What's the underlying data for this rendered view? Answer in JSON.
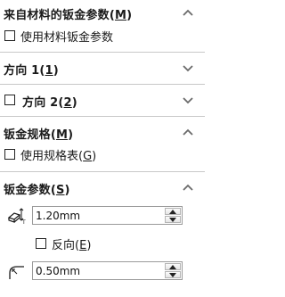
{
  "sections": {
    "custom_sheet_metal": {
      "title": "来自材料的钣金参数",
      "mnemonic": "M",
      "expanded": true,
      "use_material_checkbox_label": "使用材料钣金参数",
      "use_material_checked": false
    },
    "direction1": {
      "title": "方向 1",
      "mnemonic": "1",
      "expanded": false
    },
    "direction2": {
      "title": "方向 2",
      "mnemonic": "2",
      "expanded": false,
      "enabled_checked": false
    },
    "gauge": {
      "title": "钣金规格",
      "mnemonic": "M",
      "expanded": true,
      "use_gauge_table_label": "使用规格表",
      "use_gauge_table_mnemonic": "G",
      "use_gauge_table_checked": false
    },
    "sheet_metal_params": {
      "title": "钣金参数",
      "mnemonic": "S",
      "expanded": true,
      "thickness_value": "1.20mm",
      "reverse_label": "反向",
      "reverse_mnemonic": "E",
      "reverse_checked": false,
      "bend_radius_value": "0.50mm"
    }
  },
  "icons": {
    "expanded_chevron": "chevron-up-icon",
    "collapsed_chevron": "chevron-down-icon",
    "thickness": "thickness-icon",
    "bend_radius": "bend-radius-icon"
  },
  "colors": {
    "divider": "#c8c8c8",
    "chevron": "#6a6a6a",
    "text": "#1a1a1a"
  }
}
